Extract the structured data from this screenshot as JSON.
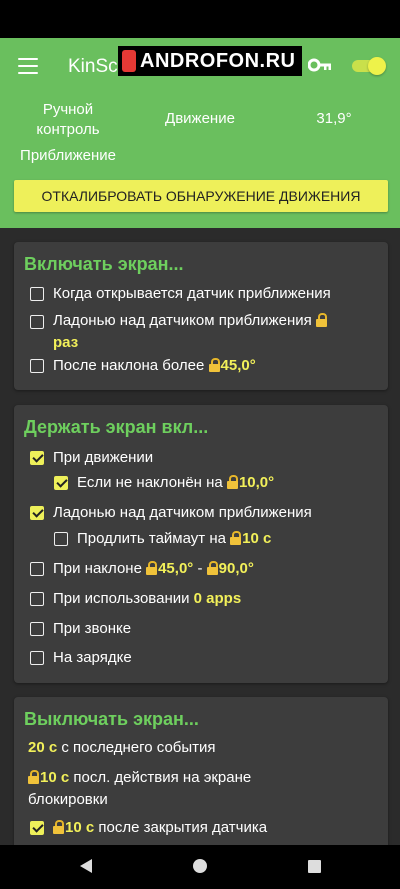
{
  "header": {
    "app_title": "KinScreen",
    "watermark": "ANDROFON.RU",
    "manual_control": "Ручной контроль",
    "motion": "Движение",
    "angle": "31,9°",
    "proximity": "Приближение",
    "calibrate_button": "ОТКАЛИБРОВАТЬ ОБНАРУЖЕНИЕ ДВИЖЕНИЯ",
    "toggle_on": true,
    "accent_color": "#6abf5e"
  },
  "turn_on": {
    "title": "Включать экран...",
    "item1": "Когда открывается датчик приближения",
    "item2": "Ладонью над датчиком приближения",
    "item2_value": "раз",
    "item3": "После наклона более",
    "item3_value": "45,0°"
  },
  "keep_on": {
    "title": "Держать экран вкл...",
    "item1": "При движении",
    "item1_sub": "Если не наклонён на",
    "item1_sub_value": "10,0°",
    "item2": "Ладонью над датчиком приближения",
    "item2_sub": "Продлить таймаут на",
    "item2_sub_value": "10 с",
    "item3": "При наклоне",
    "item3_value_from": "45,0°",
    "item3_sep": " - ",
    "item3_value_to": "90,0°",
    "item4": "При использовании",
    "item4_value": "0 apps",
    "item5": "При звонке",
    "item6": "На зарядке"
  },
  "turn_off": {
    "title": "Выключать экран...",
    "item1_value": "20 с",
    "item1": " с последнего события",
    "item2_value": "10 с",
    "item2_a": " посл. действия на экране",
    "item2_b": "блокировки",
    "item3_value": "10 с",
    "item3": " после закрытия датчика"
  },
  "icons": {
    "menu": "hamburger-menu-icon",
    "key": "key-icon",
    "lock": "lock-icon",
    "nav_back": "back-triangle-icon",
    "nav_home": "home-circle-icon",
    "nav_recent": "recents-square-icon"
  }
}
